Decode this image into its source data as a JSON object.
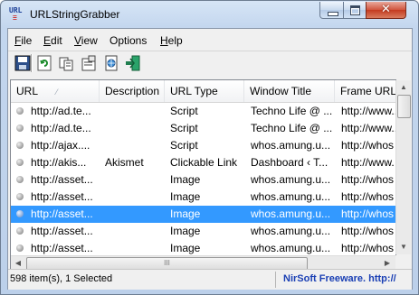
{
  "window": {
    "title": "URLStringGrabber",
    "icon_top": "URL",
    "icon_bottom": "≡",
    "controls": {
      "minimize": "minimize-icon",
      "maximize": "maximize-icon",
      "close": "✕"
    }
  },
  "menu": [
    {
      "label": "File",
      "accel": "F",
      "rest": "ile"
    },
    {
      "label": "Edit",
      "accel": "E",
      "rest": "dit"
    },
    {
      "label": "View",
      "accel": "V",
      "rest": "iew"
    },
    {
      "label": "Options",
      "accel": "",
      "rest": "Options"
    },
    {
      "label": "Help",
      "accel": "H",
      "rest": "elp"
    }
  ],
  "toolbar": [
    "save-icon",
    "refresh-icon",
    "copy-icon",
    "properties-icon",
    "html-report-icon",
    "exit-icon"
  ],
  "list": {
    "columns": [
      "URL",
      "Description",
      "URL Type",
      "Window Title",
      "Frame URL"
    ],
    "sort_indicator": "⁄",
    "rows": [
      [
        "http://ad.te...",
        "",
        "Script",
        "Techno Life @ ...",
        "http://www..."
      ],
      [
        "http://ad.te...",
        "",
        "Script",
        "Techno Life @ ...",
        "http://www..."
      ],
      [
        "http://ajax....",
        "",
        "Script",
        "whos.amung.u...",
        "http://whos"
      ],
      [
        "http://akis...",
        "Akismet",
        "Clickable Link",
        "Dashboard ‹ T...",
        "http://www."
      ],
      [
        "http://asset...",
        "",
        "Image",
        "whos.amung.u...",
        "http://whos"
      ],
      [
        "http://asset...",
        "",
        "Image",
        "whos.amung.u...",
        "http://whos"
      ],
      [
        "http://asset...",
        "",
        "Image",
        "whos.amung.u...",
        "http://whos"
      ],
      [
        "http://asset...",
        "",
        "Image",
        "whos.amung.u...",
        "http://whos"
      ],
      [
        "http://asset...",
        "",
        "Image",
        "whos.amung.u...",
        "http://whos"
      ]
    ],
    "selected_row": 6
  },
  "scroll": {
    "up": "▲",
    "down": "▼",
    "left": "◀",
    "right": "▶",
    "grip": "III"
  },
  "status": {
    "left": "598 item(s), 1 Selected",
    "right": "NirSoft Freeware.  http://"
  }
}
